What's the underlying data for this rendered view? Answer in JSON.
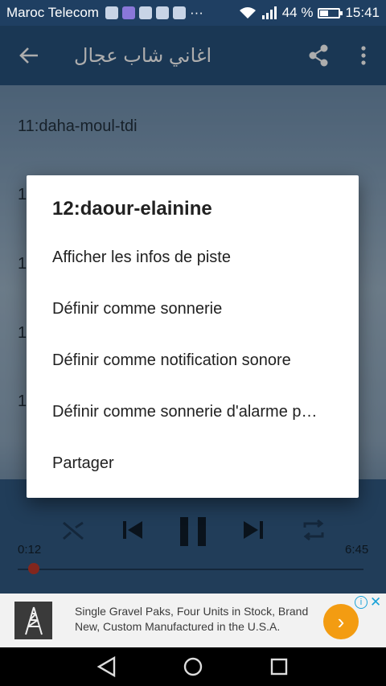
{
  "status": {
    "carrier": "Maroc Telecom",
    "more": "···",
    "battery_text": "44 %",
    "battery_level": 0.44,
    "time": "15:41"
  },
  "appbar": {
    "title": "اغاني شاب عجال"
  },
  "tracks": [
    {
      "label": "11:daha-moul-tdi"
    },
    {
      "label": "1"
    },
    {
      "label": "1"
    },
    {
      "label": "1"
    },
    {
      "label": "1"
    }
  ],
  "player": {
    "elapsed": "0:12",
    "duration": "6:45",
    "progress": 0.03
  },
  "dialog": {
    "title": "12:daour-elainine",
    "items": [
      {
        "label": "Afficher les infos de piste"
      },
      {
        "label": "Définir comme sonnerie"
      },
      {
        "label": "Définir comme notification sonore"
      },
      {
        "label": "Définir comme sonnerie d'alarme p…"
      },
      {
        "label": "Partager"
      }
    ]
  },
  "ad": {
    "text": "Single Gravel Paks, Four Units in Stock, Brand New, Custom Manufactured in the U.S.A.",
    "info": "i",
    "close": "✕",
    "go": "›"
  }
}
